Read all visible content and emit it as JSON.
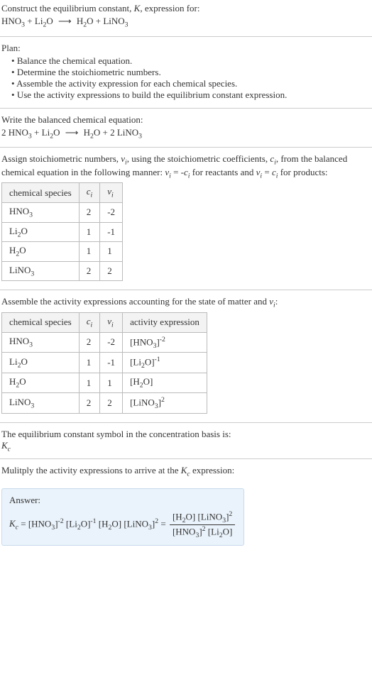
{
  "prompt": {
    "line1": "Construct the equilibrium constant, K, expression for:",
    "equation": "HNO₃ + Li₂O ⟶ H₂O + LiNO₃"
  },
  "plan": {
    "title": "Plan:",
    "items": [
      "Balance the chemical equation.",
      "Determine the stoichiometric numbers.",
      "Assemble the activity expression for each chemical species.",
      "Use the activity expressions to build the equilibrium constant expression."
    ]
  },
  "balanced": {
    "title": "Write the balanced chemical equation:",
    "equation": "2 HNO₃ + Li₂O ⟶ H₂O + 2 LiNO₃"
  },
  "stoich": {
    "intro": "Assign stoichiometric numbers, νᵢ, using the stoichiometric coefficients, cᵢ, from the balanced chemical equation in the following manner: νᵢ = -cᵢ for reactants and νᵢ = cᵢ for products:",
    "headers": {
      "species": "chemical species",
      "ci": "cᵢ",
      "vi": "νᵢ"
    },
    "rows": [
      {
        "species": "HNO₃",
        "ci": "2",
        "vi": "-2"
      },
      {
        "species": "Li₂O",
        "ci": "1",
        "vi": "-1"
      },
      {
        "species": "H₂O",
        "ci": "1",
        "vi": "1"
      },
      {
        "species": "LiNO₃",
        "ci": "2",
        "vi": "2"
      }
    ]
  },
  "activity": {
    "intro": "Assemble the activity expressions accounting for the state of matter and νᵢ:",
    "headers": {
      "species": "chemical species",
      "ci": "cᵢ",
      "vi": "νᵢ",
      "expr": "activity expression"
    },
    "rows": [
      {
        "species": "HNO₃",
        "ci": "2",
        "vi": "-2",
        "expr": "[HNO₃]⁻²"
      },
      {
        "species": "Li₂O",
        "ci": "1",
        "vi": "-1",
        "expr": "[Li₂O]⁻¹"
      },
      {
        "species": "H₂O",
        "ci": "1",
        "vi": "1",
        "expr": "[H₂O]"
      },
      {
        "species": "LiNO₃",
        "ci": "2",
        "vi": "2",
        "expr": "[LiNO₃]²"
      }
    ]
  },
  "symbol": {
    "line": "The equilibrium constant symbol in the concentration basis is:",
    "kc": "K_c"
  },
  "multiply": {
    "line": "Mulitply the activity expressions to arrive at the K_c expression:"
  },
  "answer": {
    "label": "Answer:",
    "lhs": "K_c = [HNO₃]⁻² [Li₂O]⁻¹ [H₂O] [LiNO₃]² =",
    "num": "[H₂O] [LiNO₃]²",
    "den": "[HNO₃]² [Li₂O]"
  }
}
